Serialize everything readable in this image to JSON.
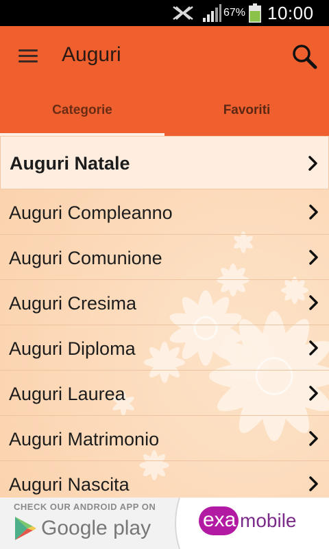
{
  "status_bar": {
    "battery_percent": "67%",
    "time": "10:00"
  },
  "app_bar": {
    "title": "Auguri",
    "color": "#f0602e"
  },
  "tabs": [
    {
      "label": "Categorie",
      "selected": true
    },
    {
      "label": "Favoriti",
      "selected": false
    }
  ],
  "list": {
    "items": [
      {
        "label": "Auguri Natale"
      },
      {
        "label": "Auguri Compleanno"
      },
      {
        "label": "Auguri Comunione"
      },
      {
        "label": "Auguri Cresima"
      },
      {
        "label": "Auguri Diploma"
      },
      {
        "label": "Auguri Laurea"
      },
      {
        "label": "Auguri Matrimonio"
      },
      {
        "label": "Auguri Nascita"
      }
    ]
  },
  "ad": {
    "check_text": "CHECK OUR ANDROID APP ON",
    "store_text": "Google play",
    "brand_part1": "exa",
    "brand_part2": "mobile"
  },
  "icons": {
    "menu": "menu-icon",
    "search": "search-icon",
    "chevron": "chevron-right-icon"
  }
}
